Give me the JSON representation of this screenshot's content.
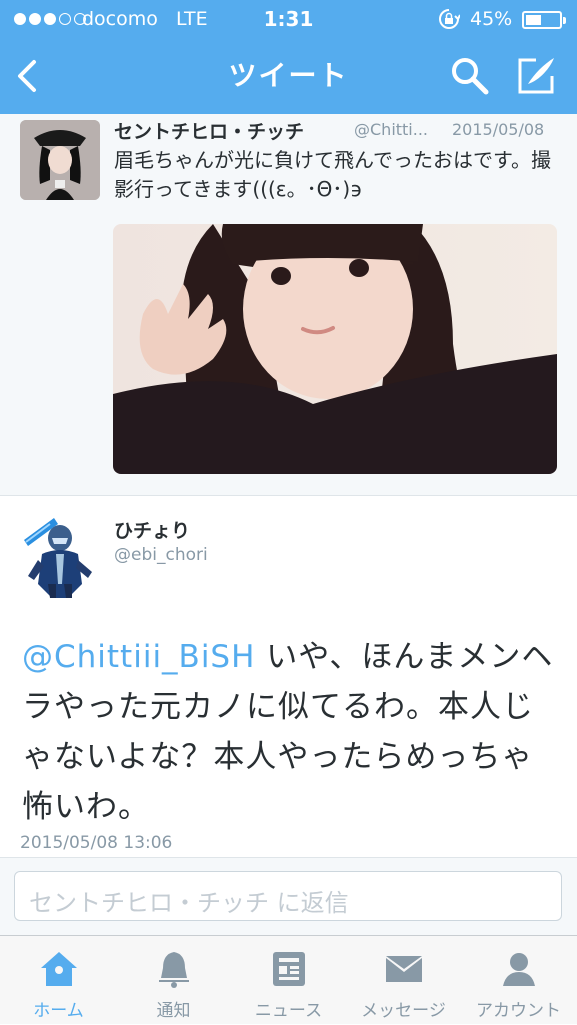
{
  "status_bar": {
    "carrier": "docomo",
    "network": "LTE",
    "time": "1:31",
    "battery_percent": "45%",
    "battery_level": 0.45,
    "signal_bars_filled": 3
  },
  "nav": {
    "title": "ツイート",
    "back_icon": "chevron-left-icon",
    "search_icon": "search-icon",
    "compose_icon": "compose-icon"
  },
  "quoted_tweet": {
    "display_name": "セントチヒロ・チッチ",
    "handle": "@Chitti...",
    "date": "2015/05/08",
    "text": "眉毛ちゃんが光に負けて飛んでったおはです。撮影行ってきます(((ε。･Θ･)϶"
  },
  "main_tweet": {
    "display_name": "ひチょり",
    "handle": "@ebi_chori",
    "mention": "@Chittiii_BiSH",
    "text": " いや、ほんまメンヘラやった元カノに似てるわ。本人じゃないよな？本人やったらめっちゃ怖いわ。",
    "timestamp": "2015/05/08 13:06"
  },
  "reply": {
    "placeholder": "セントチヒロ・チッチ に返信"
  },
  "tabs": [
    {
      "label": "ホーム",
      "icon": "home-icon",
      "active": true
    },
    {
      "label": "通知",
      "icon": "bell-icon",
      "active": false
    },
    {
      "label": "ニュース",
      "icon": "news-icon",
      "active": false
    },
    {
      "label": "メッセージ",
      "icon": "envelope-icon",
      "active": false
    },
    {
      "label": "アカウント",
      "icon": "person-icon",
      "active": false
    }
  ],
  "colors": {
    "brand": "#55acee",
    "text": "#292f33",
    "muted": "#8899a6"
  }
}
